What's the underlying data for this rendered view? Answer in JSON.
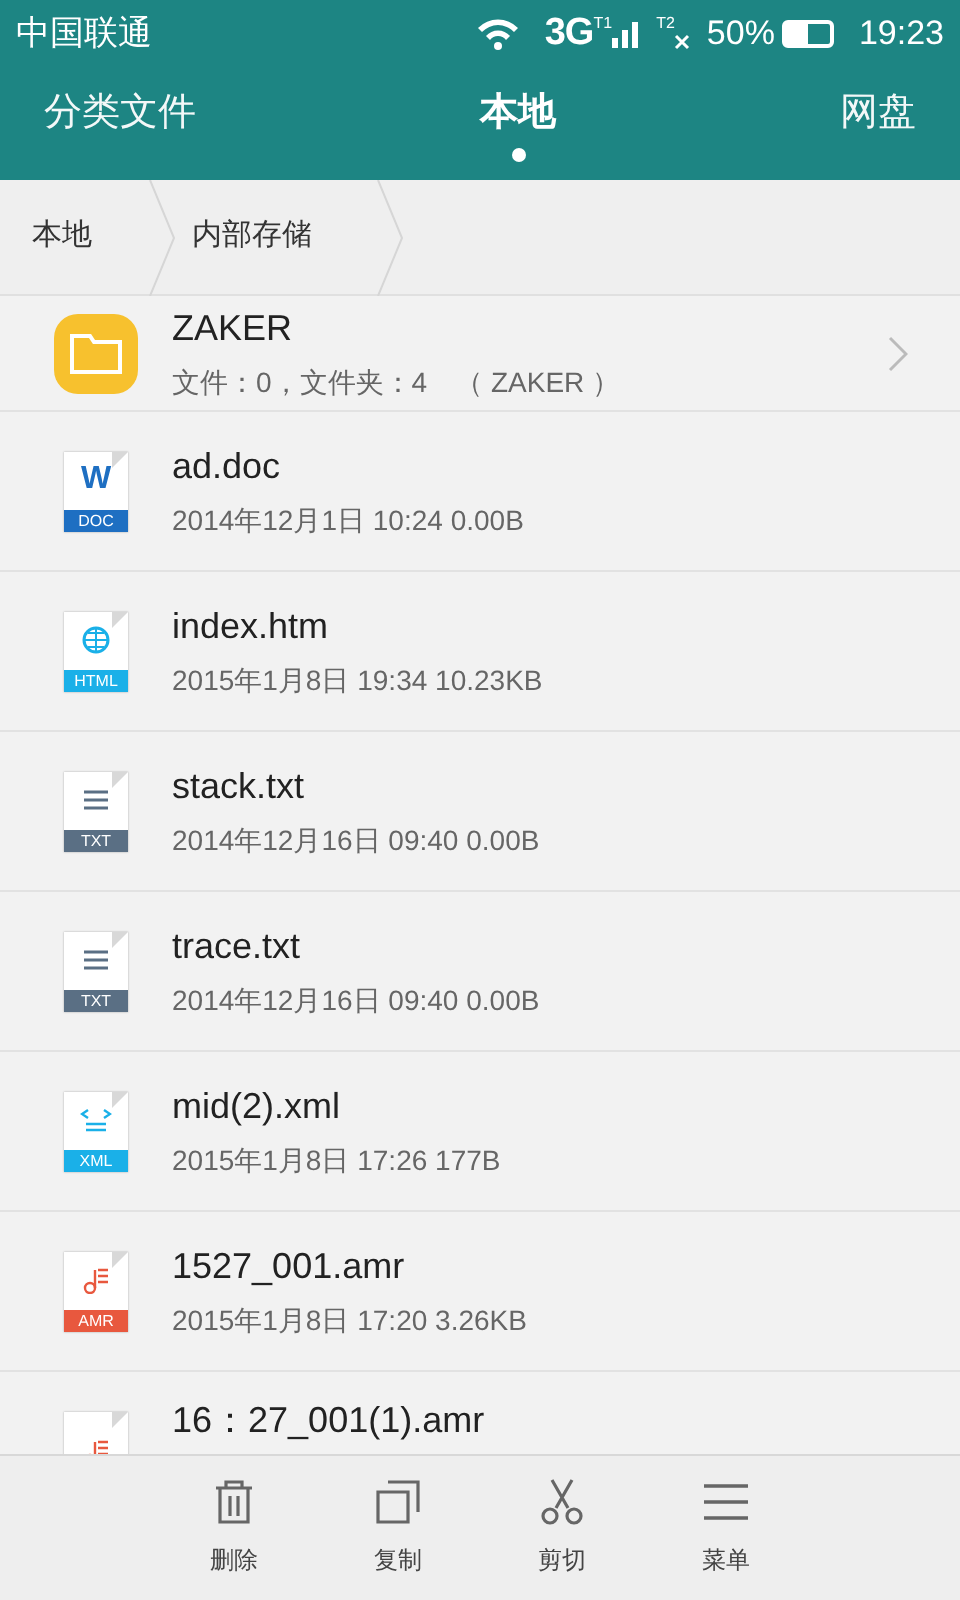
{
  "status_bar": {
    "carrier": "中国联通",
    "network": "3G",
    "sim1": "T1",
    "sim2": "T2",
    "battery_text": "50%",
    "battery": {
      "level": 0.5
    },
    "time": "19:23"
  },
  "tabs": [
    {
      "label": "分类文件",
      "selected": false
    },
    {
      "label": "本地",
      "selected": true
    },
    {
      "label": "网盘",
      "selected": false
    }
  ],
  "breadcrumb": [
    "本地",
    "内部存储"
  ],
  "files": [
    {
      "kind": "folder",
      "name": "ZAKER",
      "meta": "文件：0，文件夹：4　（ ZAKER ）"
    },
    {
      "kind": "doc",
      "badge": "DOC",
      "mark": "W",
      "name": "ad.doc",
      "meta": "2014年12月1日 10:24 0.00B"
    },
    {
      "kind": "html",
      "badge": "HTML",
      "name": "index.htm",
      "meta": "2015年1月8日 19:34 10.23KB"
    },
    {
      "kind": "txt",
      "badge": "TXT",
      "name": "stack.txt",
      "meta": "2014年12月16日 09:40 0.00B"
    },
    {
      "kind": "txt",
      "badge": "TXT",
      "name": "trace.txt",
      "meta": "2014年12月16日 09:40 0.00B"
    },
    {
      "kind": "xml",
      "badge": "XML",
      "name": "mid(2).xml",
      "meta": "2015年1月8日 17:26 177B"
    },
    {
      "kind": "amr",
      "badge": "AMR",
      "name": "1527_001.amr",
      "meta": "2015年1月8日 17:20 3.26KB"
    },
    {
      "kind": "amr",
      "name": "16：27_001(1).amr"
    }
  ],
  "toolbar": [
    {
      "kind": "delete",
      "label": "删除"
    },
    {
      "kind": "copy",
      "label": "复制"
    },
    {
      "kind": "cut",
      "label": "剪切"
    },
    {
      "kind": "menu",
      "label": "菜单"
    }
  ]
}
